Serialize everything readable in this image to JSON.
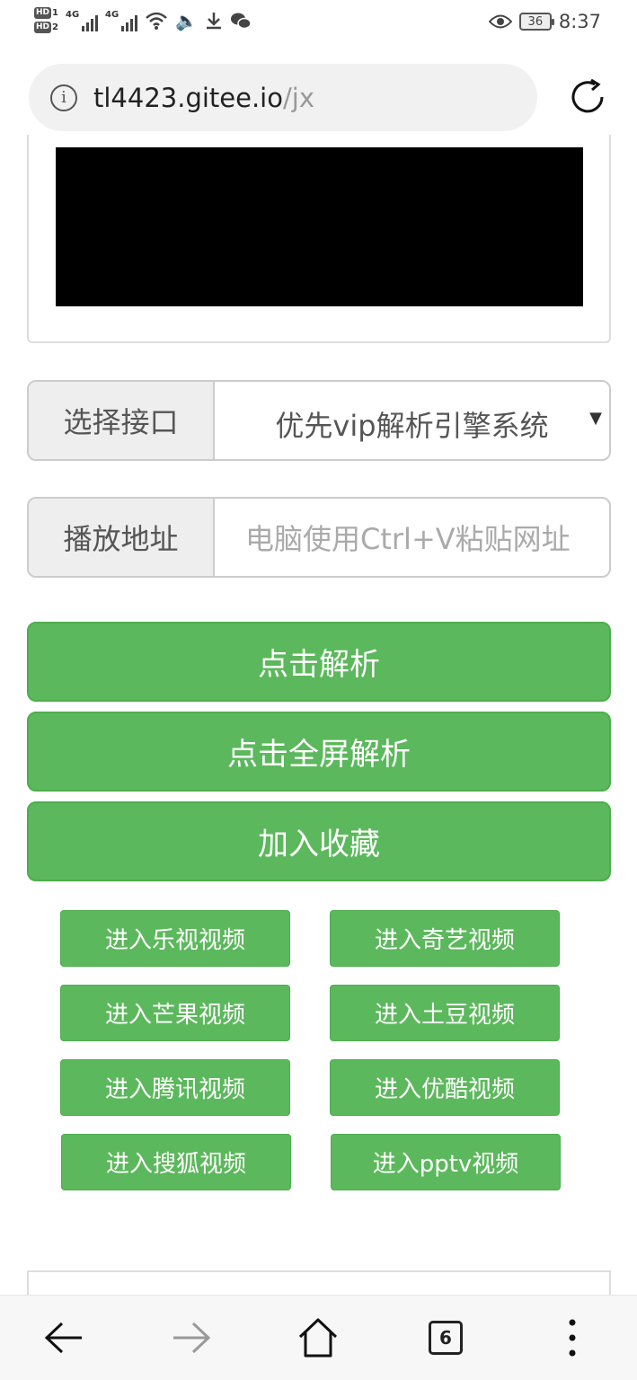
{
  "status_bar": {
    "hd1": "HD",
    "hd1_sub": "1",
    "hd2": "HD",
    "hd2_sub": "2",
    "sig1_label": "4G",
    "sig2_label": "4G",
    "battery": "36",
    "time": "8:37"
  },
  "address_bar": {
    "host": "tl4423.gitee.io",
    "path": "/jx"
  },
  "form": {
    "interface_label": "选择接口",
    "interface_value": "优先vip解析引擎系统",
    "address_label": "播放地址",
    "address_placeholder": "电脑使用Ctrl+V粘贴网址"
  },
  "buttons": {
    "parse": "点击解析",
    "fullscreen_parse": "点击全屏解析",
    "favorite": "加入收藏"
  },
  "site_links": [
    "进入乐视视频",
    "进入奇艺视频",
    "进入芒果视频",
    "进入土豆视频",
    "进入腾讯视频",
    "进入优酷视频",
    "进入搜狐视频",
    "进入pptv视频"
  ],
  "bottom_nav": {
    "tab_count": "6"
  },
  "colors": {
    "button_green": "#5cb85c",
    "button_border": "#4cae4c"
  }
}
